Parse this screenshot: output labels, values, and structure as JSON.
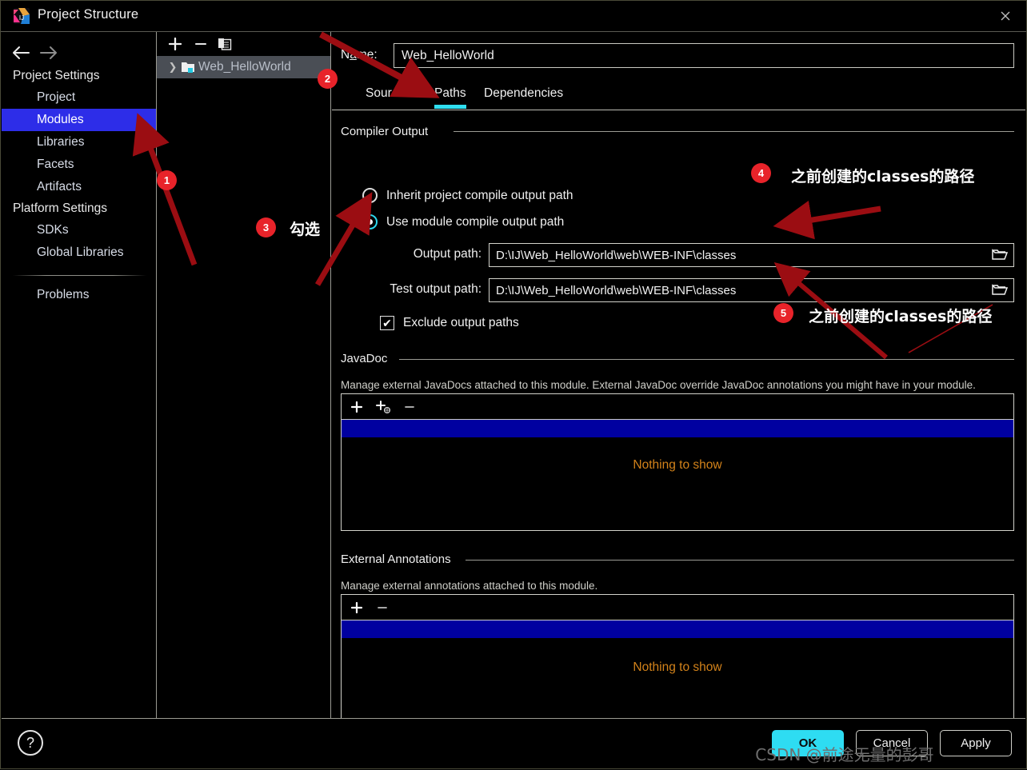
{
  "window": {
    "title": "Project Structure",
    "app_icon": "intellij-idea-icon",
    "close_label": "×"
  },
  "sidebar": {
    "back_icon": "arrow-left-icon",
    "forward_icon": "arrow-right-icon",
    "groups": [
      {
        "label": "Project Settings",
        "items": [
          {
            "label": "Project",
            "selected": false
          },
          {
            "label": "Modules",
            "selected": true
          },
          {
            "label": "Libraries",
            "selected": false
          },
          {
            "label": "Facets",
            "selected": false
          },
          {
            "label": "Artifacts",
            "selected": false
          }
        ]
      },
      {
        "label": "Platform Settings",
        "items": [
          {
            "label": "SDKs",
            "selected": false
          },
          {
            "label": "Global Libraries",
            "selected": false
          }
        ]
      }
    ],
    "problems": "Problems"
  },
  "modules_panel": {
    "toolbar": {
      "add": "+",
      "remove": "−",
      "copy_icon": "copy-icon"
    },
    "tree": [
      {
        "label": "Web_HelloWorld",
        "expand_icon": "chevron-right-icon",
        "node_icon": "module-folder-icon",
        "selected": true
      }
    ]
  },
  "main": {
    "name_label": "Name:",
    "name_value": "Web_HelloWorld",
    "tabs": [
      {
        "label": "Sources",
        "active": false
      },
      {
        "label": "Paths",
        "active": true
      },
      {
        "label": "Dependencies",
        "active": false
      }
    ],
    "compiler_output": {
      "title": "Compiler Output",
      "radio_inherit": "Inherit project compile output path",
      "radio_module": "Use module compile output path",
      "selected_option": "module",
      "output_path_label": "Output path:",
      "output_path_value": "D:\\IJ\\Web_HelloWorld\\web\\WEB-INF\\classes",
      "test_output_path_label": "Test output path:",
      "test_output_path_value": "D:\\IJ\\Web_HelloWorld\\web\\WEB-INF\\classes",
      "browse_icon": "folder-browse-icon",
      "exclude_label": "Exclude output paths",
      "exclude_checked": true,
      "check_glyph": "✔"
    },
    "javadoc": {
      "title": "JavaDoc",
      "hint": "Manage external JavaDocs attached to this module. External JavaDoc override JavaDoc annotations you might have in your module.",
      "toolbar": {
        "add": "+",
        "add_url_icon": "add-url-icon",
        "remove": "−"
      },
      "empty_text": "Nothing to show"
    },
    "external_annotations": {
      "title": "External Annotations",
      "hint": "Manage external annotations attached to this module.",
      "toolbar": {
        "add": "+",
        "remove": "−"
      },
      "empty_text": "Nothing to show"
    }
  },
  "footer": {
    "help_icon": "help-question-icon",
    "help_glyph": "?",
    "buttons": [
      {
        "label": "OK",
        "primary": true
      },
      {
        "label": "Cancel",
        "primary": false
      },
      {
        "label": "Apply",
        "primary": false
      }
    ]
  },
  "annotations": {
    "badges": [
      {
        "num": "1"
      },
      {
        "num": "2"
      },
      {
        "num": "3"
      },
      {
        "num": "4"
      },
      {
        "num": "5"
      }
    ],
    "texts": {
      "t3": "勾选",
      "t4": "之前创建的classes的路径",
      "t5": "之前创建的classes的路径"
    },
    "arrow_color": "#9b0d12",
    "badge_color": "#e8232a",
    "watermark": "CSDN @前途无量的彭哥"
  },
  "colors": {
    "accent_cyan": "#2edcf2",
    "selection_blue": "#2d2de8",
    "list_selection": "#0000a0",
    "empty_text": "#d2821a"
  }
}
